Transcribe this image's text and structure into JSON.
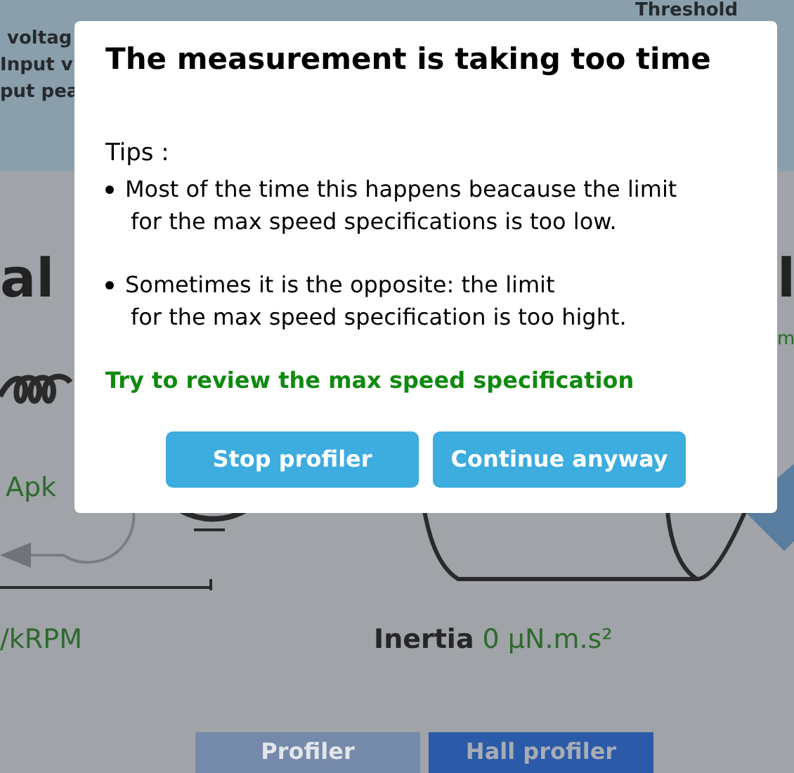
{
  "background": {
    "header_labels": [
      {
        "text": "voltag"
      },
      {
        "text": "Input v"
      },
      {
        "text": "put pea"
      },
      {
        "text": "Threshold"
      }
    ],
    "heading_left": "al",
    "heading_right": "l",
    "unit_right": "m",
    "current_unit": "Apk",
    "speed_unit": "/kRPM",
    "inertia": {
      "label": "Inertia",
      "value": "0 µN.m.s²"
    },
    "tabs": [
      {
        "label": "Profiler",
        "selected": false
      },
      {
        "label": "Hall profiler",
        "selected": true
      }
    ]
  },
  "dialog": {
    "title": "The measurement is taking too time",
    "tips_label": "Tips :",
    "tips": [
      "Most of the time this happens beacause the limit\nfor the max speed specifications is too low.",
      "Sometimes it is the opposite: the limit\nfor the max speed specification is too hight."
    ],
    "advice": "Try to review the max speed specification",
    "buttons": [
      "Stop profiler",
      "Continue anyway"
    ]
  }
}
